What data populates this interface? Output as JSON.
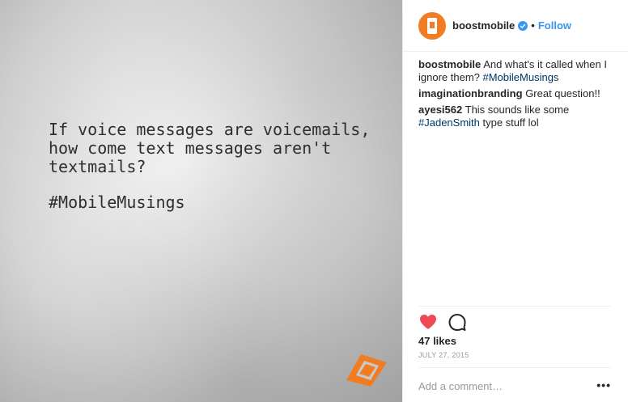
{
  "photo": {
    "quote": "If voice messages are voicemails,\nhow come text messages aren't\ntextmails?",
    "hashtag": "#MobileMusings",
    "logo_color": "#f07d23"
  },
  "header": {
    "username": "boostmobile",
    "separator": "•",
    "follow_label": "Follow",
    "avatar_icon": "boost-mobile-logo-icon",
    "verified_icon": "verified-badge-icon"
  },
  "comments": [
    {
      "author": "boostmobile",
      "text": "And what's it called when I ignore them? ",
      "tag": "#MobileMusings"
    },
    {
      "author": "imaginationbranding",
      "text": "Great question!!",
      "tag": ""
    },
    {
      "author": "ayesi562",
      "text": "This sounds like some ",
      "tag": "#JadenSmith",
      "text_after": " type stuff lol"
    }
  ],
  "actions": {
    "like_icon": "heart-icon",
    "comment_icon": "comment-bubble-icon",
    "liked": true,
    "like_color": "#ed4956"
  },
  "likes": "47 likes",
  "date": "JULY 27, 2015",
  "comment_box": {
    "placeholder": "Add a comment…",
    "more_label": "•••"
  },
  "colors": {
    "accent": "#3897f0",
    "hashtag": "#003569",
    "brand": "#f07d23"
  }
}
